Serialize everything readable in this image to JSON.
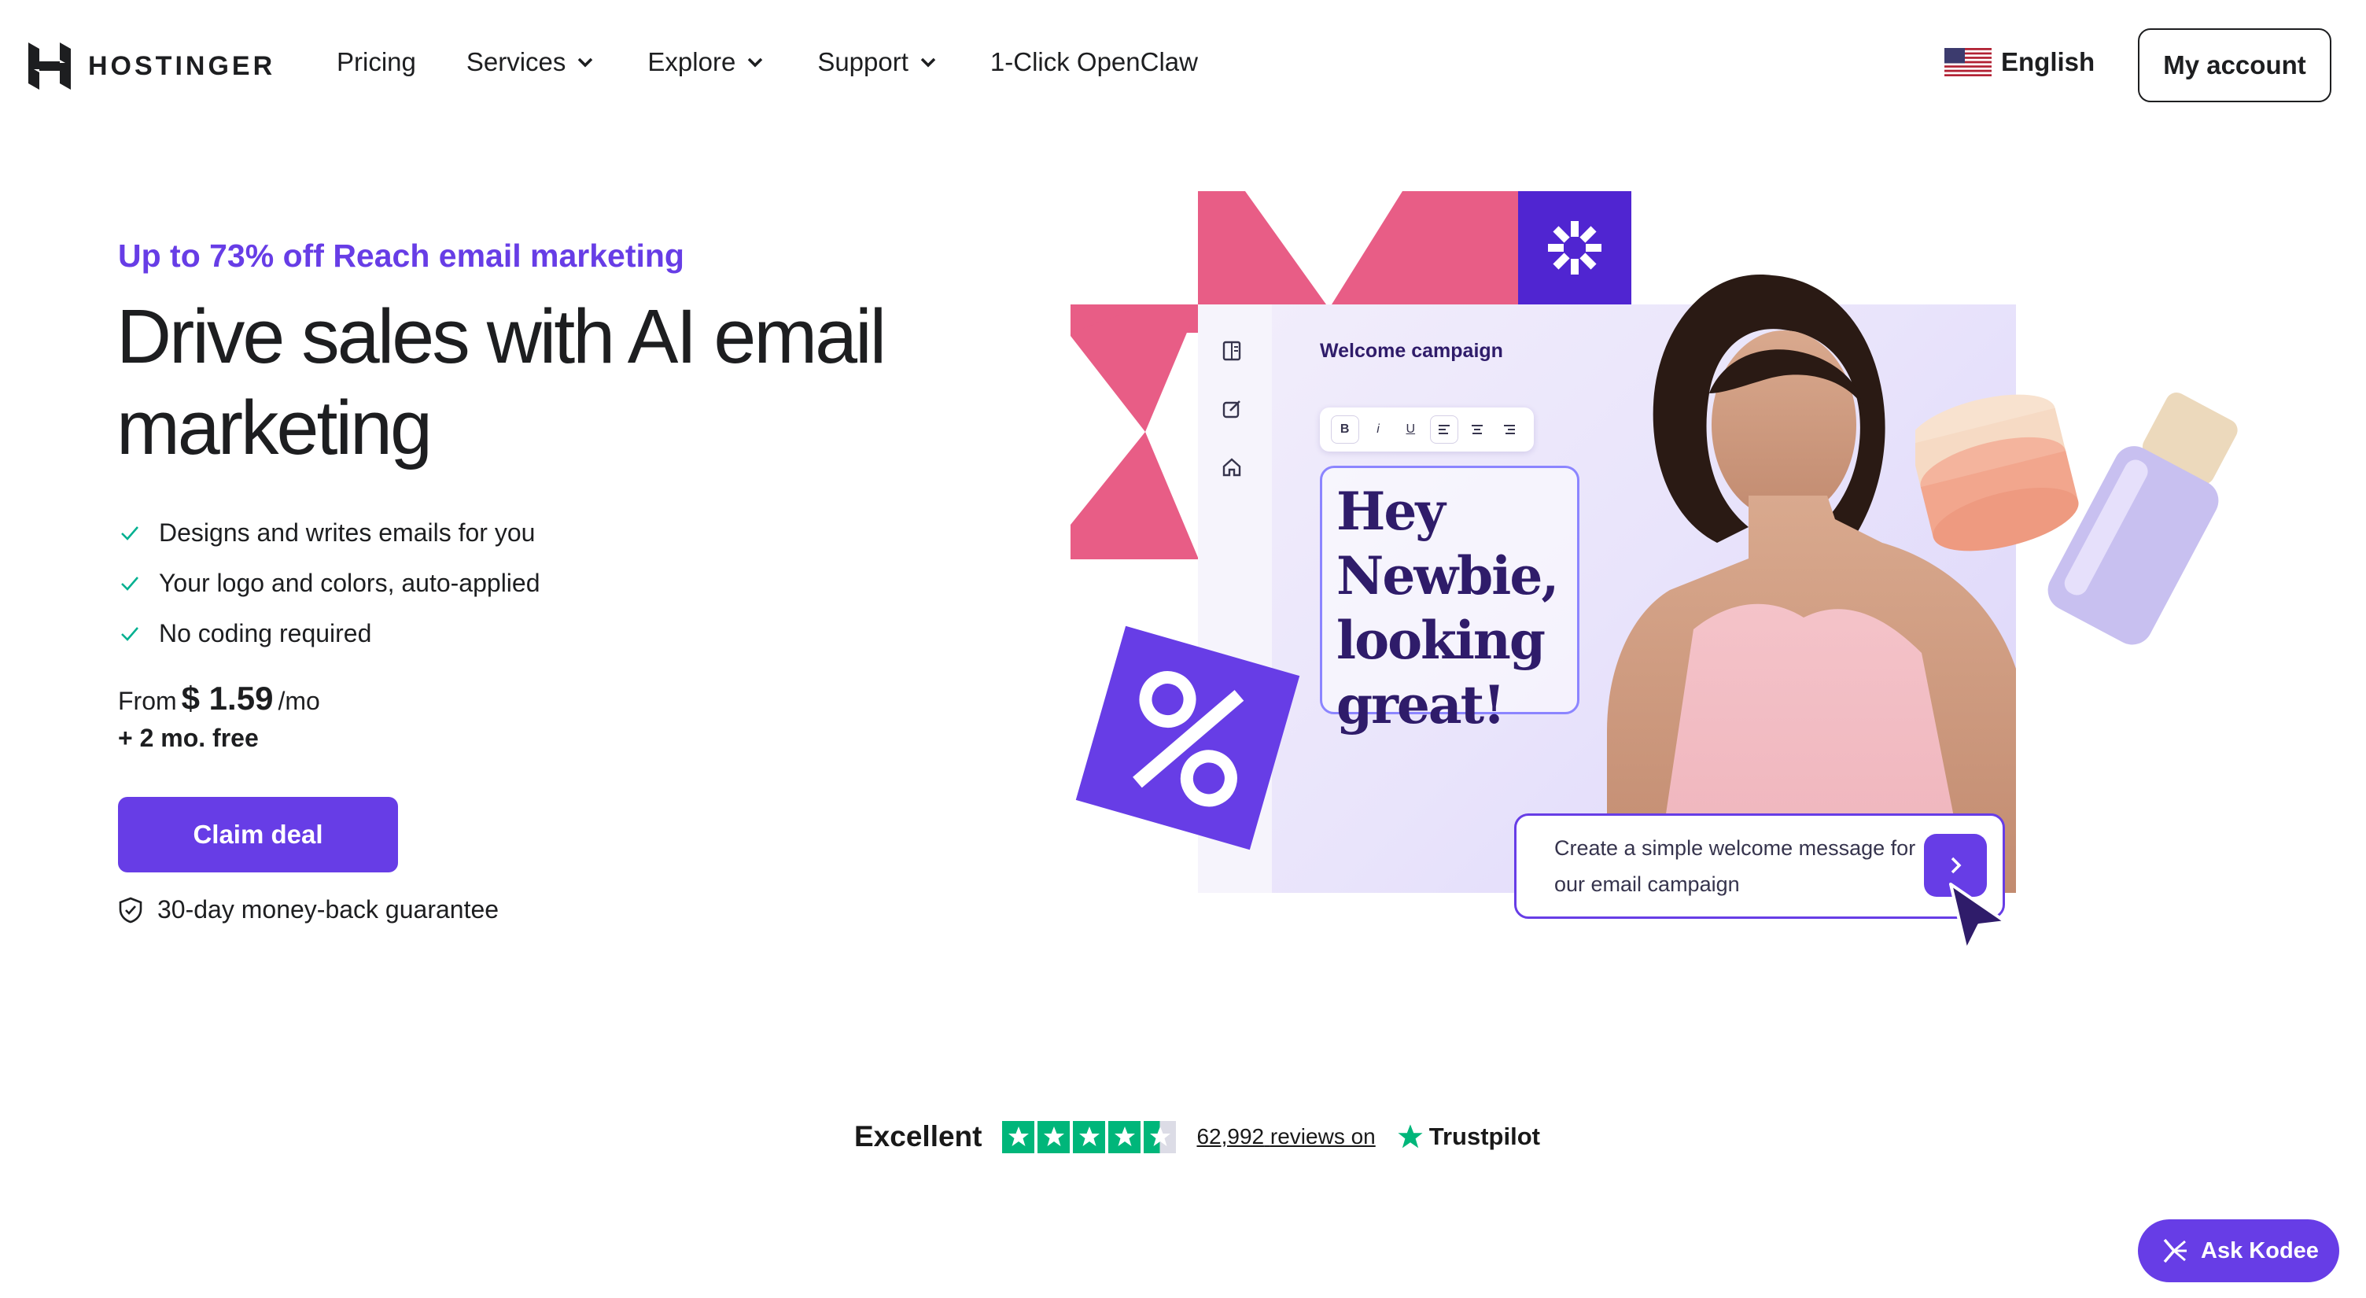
{
  "header": {
    "logo_text": "HOSTINGER",
    "nav": [
      {
        "label": "Pricing",
        "has_dropdown": false
      },
      {
        "label": "Services",
        "has_dropdown": true
      },
      {
        "label": "Explore",
        "has_dropdown": true
      },
      {
        "label": "Support",
        "has_dropdown": true
      },
      {
        "label": "1-Click OpenClaw",
        "has_dropdown": false
      }
    ],
    "language": "English",
    "account_label": "My account"
  },
  "hero": {
    "promo": "Up to 73% off Reach email marketing",
    "headline": "Drive sales with AI email marketing",
    "features": [
      "Designs and writes emails for you",
      "Your logo and colors, auto-applied",
      "No coding required"
    ],
    "price_prefix": "From",
    "price": "$ 1.59",
    "price_suffix": "/mo",
    "free_text": "+ 2 mo. free",
    "cta_label": "Claim deal",
    "guarantee": "30-day money-back guarantee"
  },
  "illustration": {
    "campaign_title": "Welcome campaign",
    "toolbar": [
      "B",
      "i",
      "U",
      "align-left",
      "align-center",
      "align-right"
    ],
    "email_greeting": "Hey Newbie, looking great!",
    "prompt_text": "Create a simple welcome message for our email campaign",
    "colors": {
      "pink": "#e85d86",
      "purple": "#673de6",
      "deep_purple": "#5025d1"
    }
  },
  "trust": {
    "rating_label": "Excellent",
    "stars": 4.5,
    "reviews_count": "62,992",
    "reviews_text": "reviews on",
    "brand": "Trustpilot"
  },
  "chat": {
    "label": "Ask Kodee"
  },
  "colors": {
    "primary": "#673de6",
    "text": "#1d1e20",
    "trustpilot_green": "#00b67a"
  }
}
